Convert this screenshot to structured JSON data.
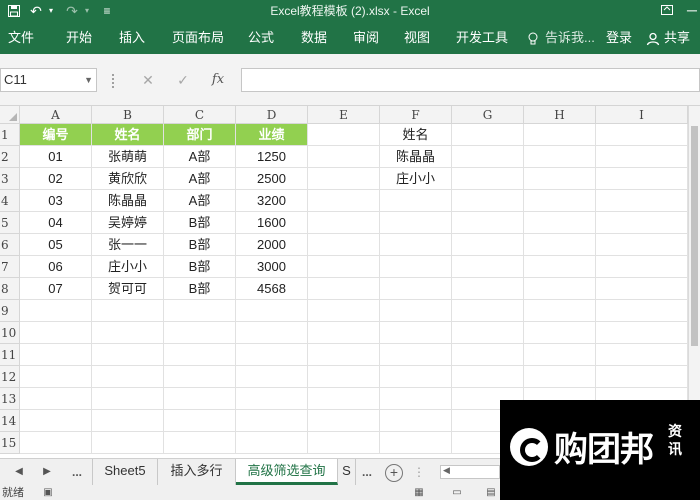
{
  "window": {
    "title": "Excel教程模板 (2).xlsx - Excel",
    "undo_glyph": "↶",
    "redo_glyph": "↷",
    "qat_more_glyph": "≡",
    "minimize_glyph": "─",
    "restore_glyph": "▢"
  },
  "ribbon": {
    "tabs": [
      "文件",
      "开始",
      "插入",
      "页面布局",
      "公式",
      "数据",
      "审阅",
      "视图",
      "开发工具"
    ],
    "tell_me": "告诉我...",
    "login": "登录",
    "share": "共享"
  },
  "formula_bar": {
    "name_box": "C11",
    "cancel_glyph": "✕",
    "enter_glyph": "✓",
    "fx_label": "fx",
    "formula": ""
  },
  "grid": {
    "columns": [
      "A",
      "B",
      "C",
      "D",
      "E",
      "F",
      "G",
      "H",
      "I"
    ],
    "rows": [
      "1",
      "2",
      "3",
      "4",
      "5",
      "6",
      "7",
      "8",
      "9",
      "10",
      "11",
      "12",
      "13",
      "14",
      "15"
    ],
    "table": {
      "headers": [
        "编号",
        "姓名",
        "部门",
        "业绩"
      ],
      "header_color": "#92d050",
      "rows": [
        [
          "01",
          "张萌萌",
          "A部",
          "1250"
        ],
        [
          "02",
          "黄欣欣",
          "A部",
          "2500"
        ],
        [
          "03",
          "陈晶晶",
          "A部",
          "3200"
        ],
        [
          "04",
          "吴婷婷",
          "B部",
          "1600"
        ],
        [
          "05",
          "张一一",
          "B部",
          "2000"
        ],
        [
          "06",
          "庄小小",
          "B部",
          "3000"
        ],
        [
          "07",
          "贺可可",
          "B部",
          "4568"
        ]
      ]
    },
    "criteria": {
      "header": "姓名",
      "values": [
        "陈晶晶",
        "庄小小"
      ]
    }
  },
  "sheets": {
    "ellipsis": "...",
    "tabs": [
      "Sheet5",
      "插入多行",
      "高级筛选查询"
    ],
    "active": "高级筛选查询",
    "next_partial": "S",
    "add_glyph": "+"
  },
  "status": {
    "text": "就绪"
  },
  "watermark": {
    "brand": "购团邦",
    "sub": "资讯"
  },
  "colors": {
    "excel_green": "#217346",
    "table_header_green": "#92d050"
  }
}
